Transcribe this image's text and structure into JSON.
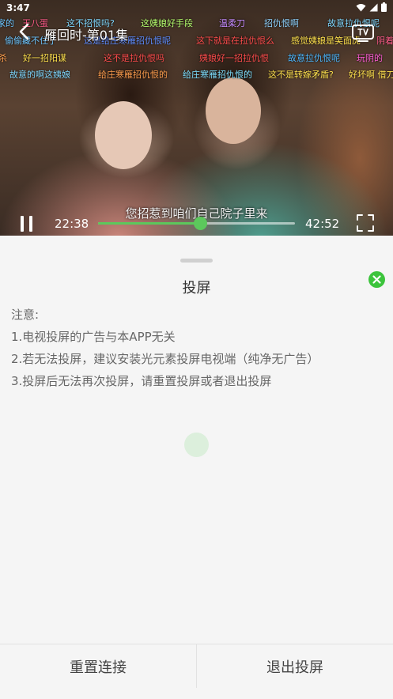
{
  "status_bar": {
    "time": "3:47"
  },
  "player": {
    "title": "雁回时-第01集",
    "subtitle": "您招惹到咱们自己院子里来",
    "current_time": "22:38",
    "total_time": "42:52",
    "progress": 0.52,
    "accent_color": "#5cc85c"
  },
  "danmaku": [
    {
      "text": "家的",
      "color": "#6ec6ff"
    },
    {
      "text": "王八蛋",
      "color": "#ff5c8a"
    },
    {
      "text": "这不招恨吗?",
      "color": "#7fd8ff"
    },
    {
      "text": "这姨娘好手段",
      "color": "#b6ff6e"
    },
    {
      "text": "温柔刀",
      "color": "#c58bff"
    },
    {
      "text": "招仇恨啊",
      "color": "#8fd3ff"
    },
    {
      "text": "故意拉仇恨呢",
      "color": "#7fd8ff"
    },
    {
      "text": "偷偷藏不住了",
      "color": "#6ec6ff"
    },
    {
      "text": "这是给庄寒雁招仇恨呢",
      "color": "#5f8dff"
    },
    {
      "text": "这下就是在拉仇恨么",
      "color": "#ff4d4d"
    },
    {
      "text": "感觉姨娘是笑面虎",
      "color": "#ffe14d"
    },
    {
      "text": "阴着",
      "color": "#ff5c8a"
    },
    {
      "text": "杀",
      "color": "#ff9e4d"
    },
    {
      "text": "好一招阳谋",
      "color": "#ffe14d"
    },
    {
      "text": "这不是拉仇恨吗",
      "color": "#ff4d4d"
    },
    {
      "text": "姨娘好一招拉仇恨",
      "color": "#ff4d4d"
    },
    {
      "text": "故意拉仇恨呢",
      "color": "#4db8ff"
    },
    {
      "text": "玩阴的",
      "color": "#ff5cd6"
    },
    {
      "text": "故意的啊这姨娘",
      "color": "#7fd8ff"
    },
    {
      "text": "给庄寒雁招仇恨的",
      "color": "#ff9e4d"
    },
    {
      "text": "给庄寒雁招仇恨的",
      "color": "#7fe0ff"
    },
    {
      "text": "这不是转嫁矛盾?",
      "color": "#ffe14d"
    },
    {
      "text": "好坏啊 借刀",
      "color": "#ffe14d"
    }
  ],
  "icons": {
    "back": "back-arrow-icon",
    "tv": "tv-icon",
    "pause": "pause-icon",
    "fullscreen": "fullscreen-icon",
    "close": "close-icon"
  },
  "sheet": {
    "title": "投屏",
    "notice_head": "注意:",
    "notices": [
      "1.电视投屏的广告与本APP无关",
      "2.若无法投屏，建议安装光元素投屏电视端（纯净无广告）",
      "3.投屏后无法再次投屏，请重置投屏或者退出投屏"
    ],
    "reset_label": "重置连接",
    "exit_label": "退出投屏",
    "close_color": "#3cc43c"
  }
}
